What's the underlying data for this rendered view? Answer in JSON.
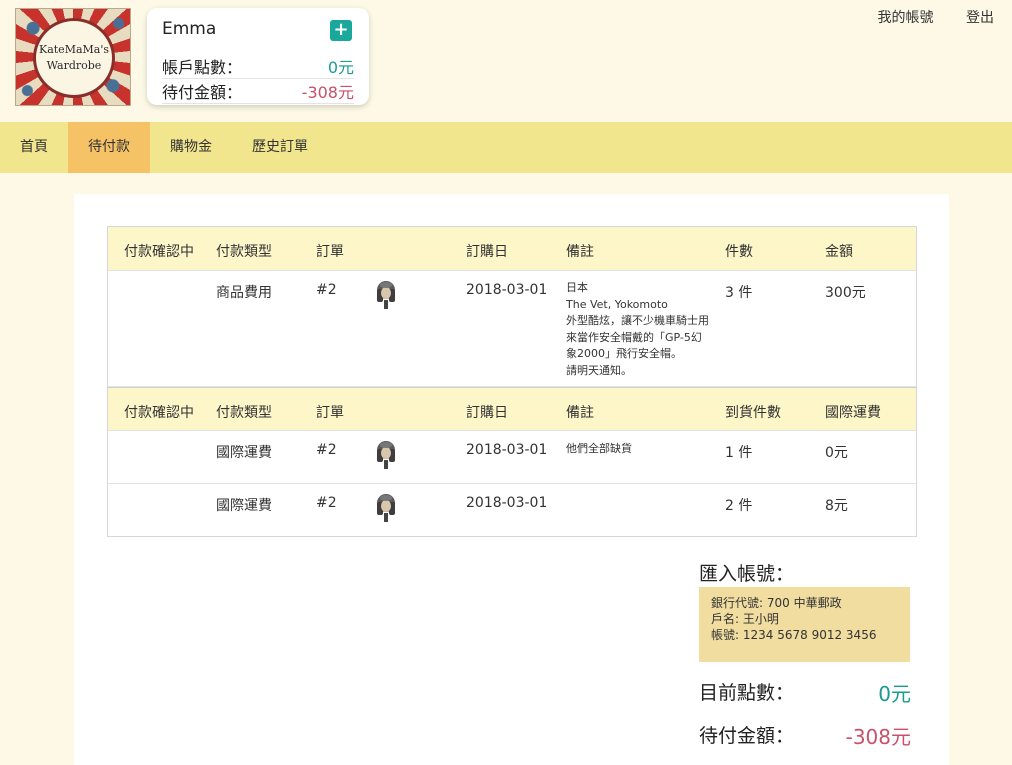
{
  "logo": {
    "line1": "KateMaMa's",
    "line2": "Wardrobe"
  },
  "account": {
    "name": "Emma",
    "points_label": "帳戶點數：",
    "points_value": "0元",
    "due_label": "待付金額：",
    "due_value": "-308元"
  },
  "top_links": [
    "我的帳號",
    "登出"
  ],
  "nav": [
    "首頁",
    "待付款",
    "購物金",
    "歷史訂單"
  ],
  "table1": {
    "headers": [
      "付款確認中",
      "付款類型",
      "訂單",
      "訂購日",
      "備註",
      "件數",
      "金額"
    ],
    "rows": [
      {
        "type": "商品費用",
        "order": "#2",
        "date": "2018-03-01",
        "note": [
          "日本",
          "The Vet, Yokomoto",
          "外型酷炫，讓不少機車騎士用",
          "來當作安全帽戴的「GP-5幻",
          "象2000」飛行安全帽。",
          "請明天通知。"
        ],
        "qty": "3 件",
        "amount": "300元"
      }
    ]
  },
  "table2": {
    "headers": [
      "付款確認中",
      "付款類型",
      "訂單",
      "訂購日",
      "備註",
      "到貨件數",
      "國際運費"
    ],
    "rows": [
      {
        "type": "國際運費",
        "order": "#2",
        "date": "2018-03-01",
        "note": "他們全部缺貨",
        "qty": "1 件",
        "amount": "0元"
      },
      {
        "type": "國際運費",
        "order": "#2",
        "date": "2018-03-01",
        "note": "",
        "qty": "2 件",
        "amount": "8元"
      }
    ]
  },
  "summary": {
    "bank_title": "匯入帳號：",
    "bank_lines": [
      "銀行代號: 700 中華郵政",
      "戶名: 王小明",
      "帳號: 1234 5678 9012 3456"
    ],
    "points_label": "目前點數：",
    "points_value": "0元",
    "due_label": "待付金額：",
    "due_value": "-308元"
  },
  "colors": {
    "accent_teal": "#1aa89c",
    "due_red": "#c8506a",
    "nav_bg": "#f1e68e",
    "nav_active": "#f6c266"
  },
  "icons": {
    "add": "plus-icon",
    "product": "helmet-thumbnail"
  }
}
